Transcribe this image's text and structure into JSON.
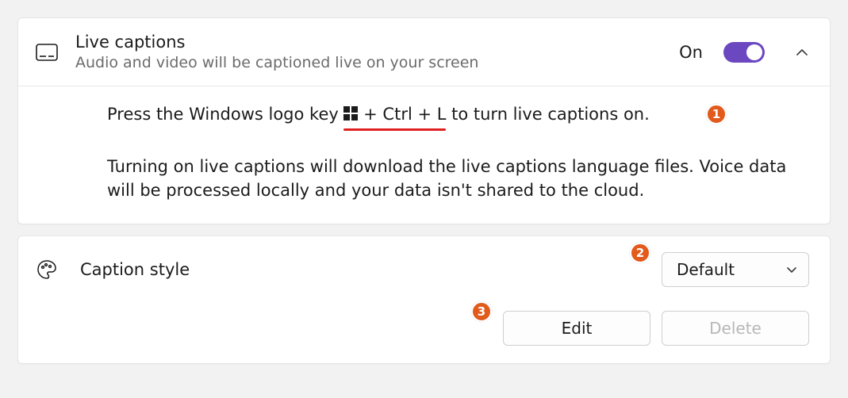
{
  "live_captions": {
    "title": "Live captions",
    "subtitle": "Audio and video will be captioned live on your screen",
    "state_label": "On",
    "line1_pre": "Press the Windows logo key ",
    "line1_shortcut": " + Ctrl + L",
    "line1_post": " to turn live captions on.",
    "para2": "Turning on live captions will download the live captions language files. Voice data will be processed locally and your data isn't shared to the cloud."
  },
  "caption_style": {
    "label": "Caption style",
    "selected": "Default",
    "edit": "Edit",
    "delete": "Delete"
  },
  "annotations": {
    "b1": "1",
    "b2": "2",
    "b3": "3"
  }
}
